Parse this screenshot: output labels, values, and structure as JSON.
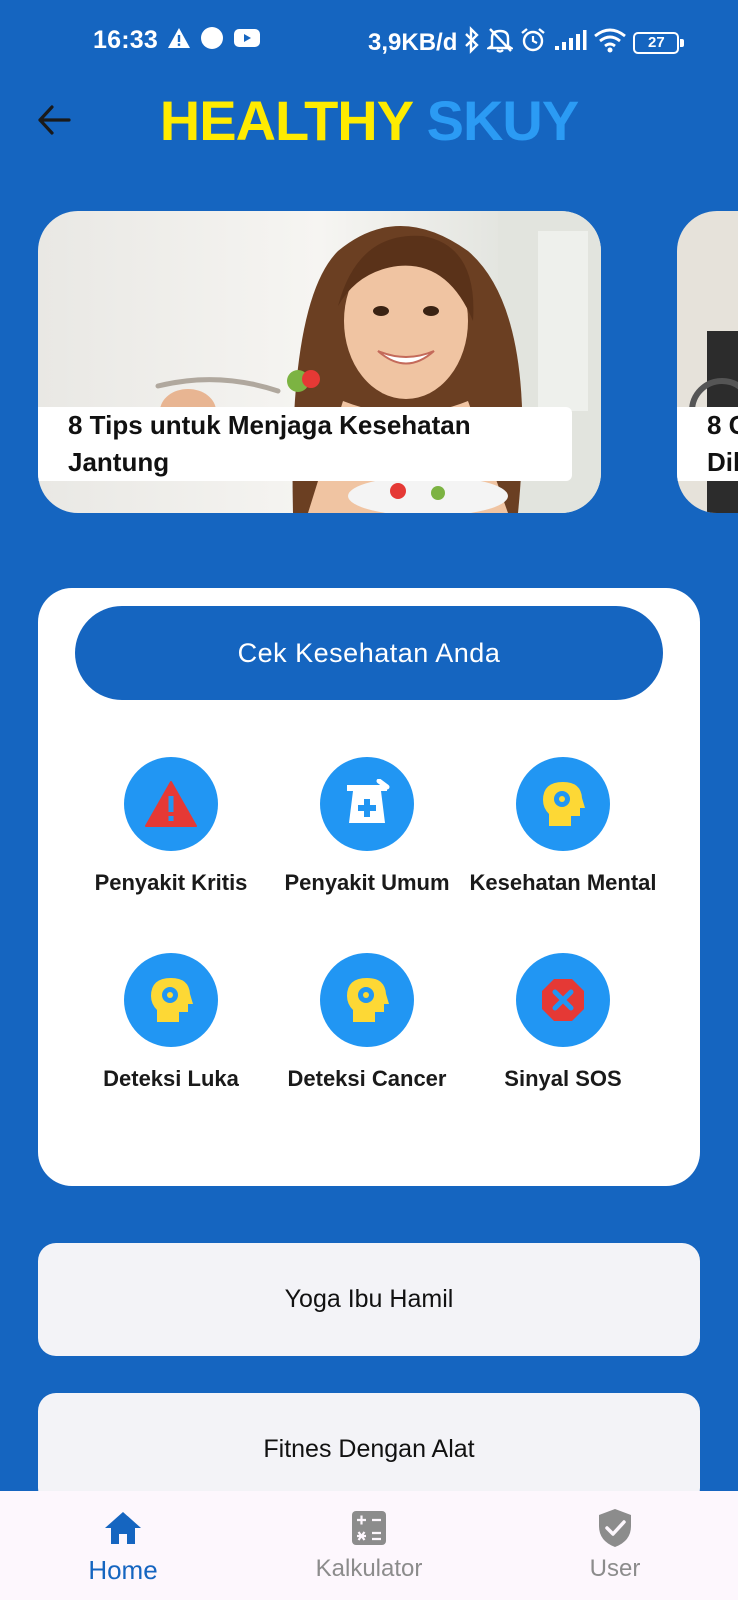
{
  "status_bar": {
    "time": "16:33",
    "speed": "3,9KB/d",
    "battery": "27"
  },
  "header": {
    "title_part1": "HEALTHY",
    "title_part2": "SKUY"
  },
  "carousel": {
    "slides": [
      {
        "title": "8 Tips untuk Menjaga Kesehatan Jantung"
      },
      {
        "title": "8 C\nDil"
      }
    ]
  },
  "health_check": {
    "button_label": "Cek Kesehatan Anda",
    "items": [
      {
        "label": "Penyakit Kritis",
        "icon": "warning-icon"
      },
      {
        "label": "Penyakit Umum",
        "icon": "medicine-icon"
      },
      {
        "label": "Kesehatan Mental",
        "icon": "head-gear-icon"
      },
      {
        "label": "Deteksi Luka",
        "icon": "head-gear-icon"
      },
      {
        "label": "Deteksi Cancer",
        "icon": "head-gear-icon"
      },
      {
        "label": "Sinyal SOS",
        "icon": "cancel-icon"
      }
    ]
  },
  "list": {
    "items": [
      {
        "label": "Yoga Ibu Hamil"
      },
      {
        "label": "Fitnes Dengan Alat"
      }
    ]
  },
  "bottom_nav": {
    "items": [
      {
        "label": "Home",
        "icon": "home-icon",
        "active": true
      },
      {
        "label": "Kalkulator",
        "icon": "calculator-icon",
        "active": false
      },
      {
        "label": "User",
        "icon": "shield-check-icon",
        "active": false
      }
    ]
  },
  "colors": {
    "background": "#1565c0",
    "accent_yellow": "#ffeb00",
    "accent_blue": "#2b9bf4",
    "icon_circle": "#2196f3",
    "icon_red": "#e53935",
    "icon_yellow": "#fdd835"
  }
}
